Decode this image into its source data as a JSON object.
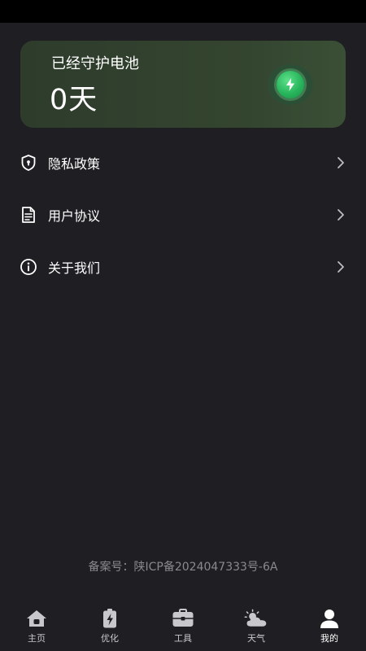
{
  "card": {
    "title": "已经守护电池",
    "days": "0天",
    "icon": "battery-bolt-icon"
  },
  "menu": [
    {
      "label": "隐私政策",
      "icon": "shield-icon"
    },
    {
      "label": "用户协议",
      "icon": "document-icon"
    },
    {
      "label": "关于我们",
      "icon": "info-icon"
    }
  ],
  "icp": "备案号：陕ICP备2024047333号-6A",
  "tabs": [
    {
      "label": "主页",
      "icon": "home-icon"
    },
    {
      "label": "优化",
      "icon": "battery-icon"
    },
    {
      "label": "工具",
      "icon": "toolbox-icon"
    },
    {
      "label": "天气",
      "icon": "weather-icon"
    },
    {
      "label": "我的",
      "icon": "profile-icon",
      "active": true
    }
  ],
  "colors": {
    "background": "#1f1f23",
    "card_accent": "#27b55b",
    "muted_text": "#8a8a8e"
  }
}
